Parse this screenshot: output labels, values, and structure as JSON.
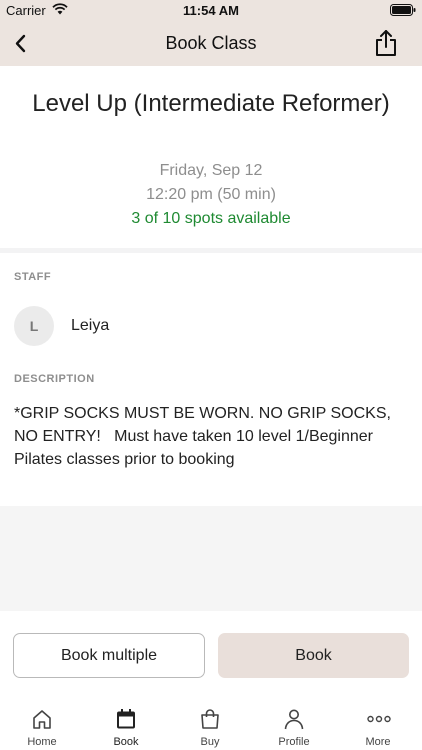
{
  "status_bar": {
    "carrier": "Carrier",
    "time": "11:54 AM"
  },
  "nav": {
    "title": "Book Class",
    "back_icon": "chevron-left-icon",
    "share_icon": "share-icon"
  },
  "class_info": {
    "title": "Level Up (Intermediate Reformer)",
    "date": "Friday, Sep 12",
    "time": "12:20 pm (50 min)",
    "spots": "3 of 10 spots available",
    "spots_color": "#1f8a32"
  },
  "staff": {
    "label": "STAFF",
    "initial": "L",
    "name": "Leiya"
  },
  "description": {
    "label": "DESCRIPTION",
    "text": "*GRIP SOCKS MUST BE WORN. NO GRIP SOCKS, NO ENTRY!   Must have taken 10 level 1/Beginner Pilates classes prior to booking"
  },
  "actions": {
    "book_multiple": "Book multiple",
    "book": "Book",
    "book_color": "#e9dfda"
  },
  "tabs": [
    {
      "label": "Home",
      "icon": "home-icon"
    },
    {
      "label": "Book",
      "icon": "calendar-icon"
    },
    {
      "label": "Buy",
      "icon": "shopping-bag-icon"
    },
    {
      "label": "Profile",
      "icon": "person-icon"
    },
    {
      "label": "More",
      "icon": "more-dots-icon"
    }
  ],
  "active_tab": "Book"
}
